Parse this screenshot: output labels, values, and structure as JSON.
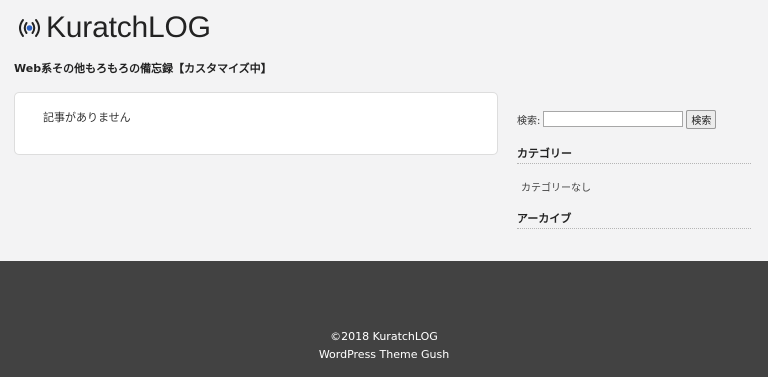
{
  "header": {
    "site_title": "KuratchLOG",
    "tagline": "Web系その他もろもろの備忘録【カスタマイズ中】",
    "logo_icon": "radio-signal-icon",
    "accent_color": "#2b5fc0"
  },
  "main": {
    "no_posts_text": "記事がありません"
  },
  "sidebar": {
    "search_label": "検索:",
    "search_value": "",
    "search_button": "検索",
    "categories_title": "カテゴリー",
    "categories_empty": "カテゴリーなし",
    "archives_title": "アーカイブ"
  },
  "footer": {
    "copyright": "©2018 KuratchLOG",
    "theme_credit": "WordPress Theme Gush"
  }
}
